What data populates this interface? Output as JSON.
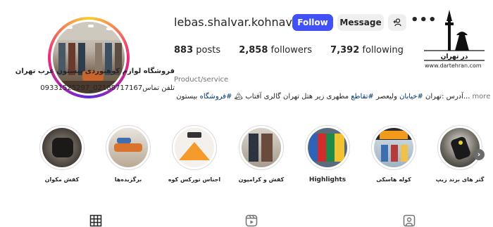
{
  "profile": {
    "username": "lebas.shalvar.kohnavardi",
    "follow_label": "Follow",
    "message_label": "Message",
    "add_user_icon": "add-user-icon",
    "more_icon": "more-options-icon",
    "stats": {
      "posts_count": "883",
      "posts_label": "posts",
      "followers_count": "2,858",
      "followers_label": "followers",
      "following_count": "7,392",
      "following_label": "following"
    },
    "bio": {
      "name": "فروشگاه لوازم کوهنوردی بیستون غرب تهران",
      "category": "Product/service",
      "phone_line": "تلفن تماس02188717167_09331525297",
      "address_prefix": "...آدرس :تهران ",
      "address_tag1": "#خیابان",
      "address_mid": " ولیعصر ",
      "address_tag2": "#تقاطع",
      "address_rest": " مطهری زیر هتل تهران گالری آفتاب 🏔 ",
      "address_tag3": "#فروشگاه",
      "address_end": " بیستون",
      "more_label": "more"
    }
  },
  "watermark": {
    "logo_text": "در تهران",
    "url": "www.dartehran.com"
  },
  "highlights": [
    {
      "label": "گتر های برند زیپ"
    },
    {
      "label": "کوله هاسکی"
    },
    {
      "label": "Highlights"
    },
    {
      "label": "کفش و کرامپون"
    },
    {
      "label": "اجناس تورکس کوه"
    },
    {
      "label": "برگزیده‌ها"
    },
    {
      "label": "کفش مکوان"
    }
  ],
  "tabs": [
    "posts-grid-icon",
    "reels-icon",
    "tagged-icon"
  ],
  "colors": {
    "follow_button": "#4150f7",
    "secondary_button": "#efefef",
    "text": "#262626",
    "muted": "#737373",
    "hashtag": "#00376b"
  }
}
